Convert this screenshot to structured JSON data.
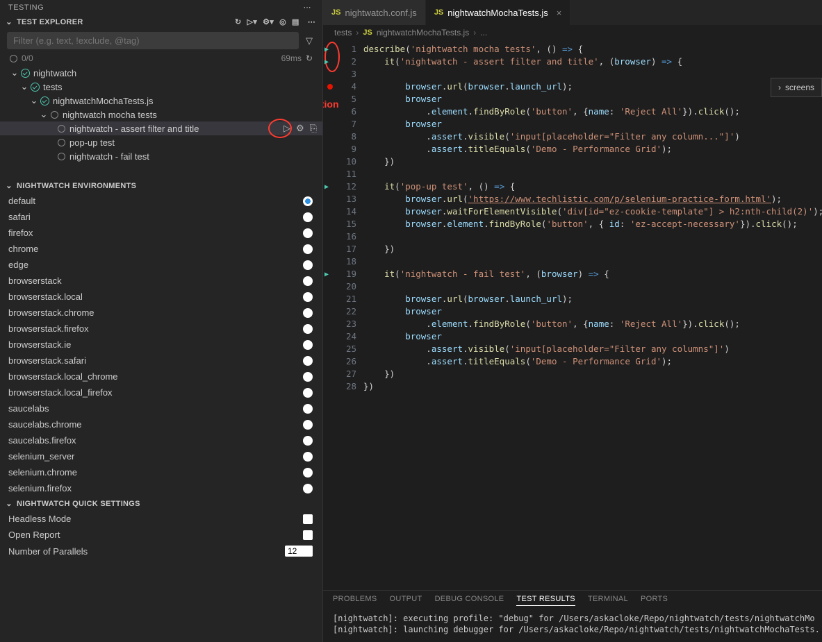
{
  "sidebar": {
    "panel_title": "TESTING",
    "explorer": {
      "title": "TEST EXPLORER",
      "filter_placeholder": "Filter (e.g. text, !exclude, @tag)",
      "stats_count": "0/0",
      "stats_time": "69ms"
    },
    "tree": {
      "root": "nightwatch",
      "tests_folder": "tests",
      "file": "nightwatchMochaTests.js",
      "suite": "nightwatch mocha tests",
      "tests": [
        "nightwatch - assert filter and title",
        "pop-up test",
        "nightwatch - fail test"
      ]
    },
    "envs": {
      "title": "NIGHTWATCH ENVIRONMENTS",
      "items": [
        "default",
        "safari",
        "firefox",
        "chrome",
        "edge",
        "browserstack",
        "browserstack.local",
        "browserstack.chrome",
        "browserstack.firefox",
        "browserstack.ie",
        "browserstack.safari",
        "browserstack.local_chrome",
        "browserstack.local_firefox",
        "saucelabs",
        "saucelabs.chrome",
        "saucelabs.firefox",
        "selenium_server",
        "selenium.chrome",
        "selenium.firefox"
      ],
      "selected_index": 0
    },
    "quick": {
      "title": "NIGHTWATCH QUICK SETTINGS",
      "headless": "Headless Mode",
      "open_report": "Open Report",
      "parallels_label": "Number of Parallels",
      "parallels_value": "12"
    }
  },
  "tabs": {
    "inactive": "nightwatch.conf.js",
    "active": "nightwatchMochaTests.js"
  },
  "breadcrumb": {
    "tests": "tests",
    "file": "nightwatchMochaTests.js",
    "trail": "..."
  },
  "annotation_label": "Test Execution",
  "floater": {
    "label": "screens"
  },
  "code": {
    "l1": {
      "a": "describe",
      "b": "(",
      "c": "'nightwatch mocha tests'",
      "d": ", () ",
      "e": "=>",
      "f": " {"
    },
    "l2": {
      "a": "    it",
      "b": "(",
      "c": "'nightwatch - assert filter and title'",
      "d": ", (",
      "e": "browser",
      "f": ") ",
      "g": "=>",
      "h": " {"
    },
    "l4": {
      "a": "        browser",
      "b": ".",
      "c": "url",
      "d": "(",
      "e": "browser",
      "f": ".",
      "g": "launch_url",
      "h": ");"
    },
    "l5": {
      "a": "        browser"
    },
    "l6": {
      "a": "            .",
      "b": "element",
      "c": ".",
      "d": "findByRole",
      "e": "(",
      "f": "'button'",
      "g": ", {",
      "h": "name",
      "i": ": ",
      "j": "'Reject All'",
      "k": "}).",
      "l": "click",
      "m": "();"
    },
    "l7": {
      "a": "        browser"
    },
    "l8": {
      "a": "            .",
      "b": "assert",
      "c": ".",
      "d": "visible",
      "e": "(",
      "f": "'input[placeholder=\"Filter any column...\"]'",
      "g": ")"
    },
    "l9": {
      "a": "            .",
      "b": "assert",
      "c": ".",
      "d": "titleEquals",
      "e": "(",
      "f": "'Demo - Performance Grid'",
      "g": ");"
    },
    "l10": {
      "a": "    })"
    },
    "l12": {
      "a": "    it",
      "b": "(",
      "c": "'pop-up test'",
      "d": ", () ",
      "e": "=>",
      "f": " {"
    },
    "l13": {
      "a": "        browser",
      "b": ".",
      "c": "url",
      "d": "(",
      "e": "'https://www.techlistic.com/p/selenium-practice-form.html'",
      "f": ");"
    },
    "l14": {
      "a": "        browser",
      "b": ".",
      "c": "waitForElementVisible",
      "d": "(",
      "e": "'div[id=\"ez-cookie-template\"] > h2:nth-child(2)'",
      "f": ");"
    },
    "l15": {
      "a": "        browser",
      "b": ".",
      "c": "element",
      "d": ".",
      "e": "findByRole",
      "f": "(",
      "g": "'button'",
      "h": ", { ",
      "i": "id",
      "j": ": ",
      "k": "'ez-accept-necessary'",
      "l": "}).",
      "m": "click",
      "n": "();"
    },
    "l17": {
      "a": "    })"
    },
    "l19": {
      "a": "    it",
      "b": "(",
      "c": "'nightwatch - fail test'",
      "d": ", (",
      "e": "browser",
      "f": ") ",
      "g": "=>",
      "h": " {"
    },
    "l21": {
      "a": "        browser",
      "b": ".",
      "c": "url",
      "d": "(",
      "e": "browser",
      "f": ".",
      "g": "launch_url",
      "h": ");"
    },
    "l22": {
      "a": "        browser"
    },
    "l23": {
      "a": "            .",
      "b": "element",
      "c": ".",
      "d": "findByRole",
      "e": "(",
      "f": "'button'",
      "g": ", {",
      "h": "name",
      "i": ": ",
      "j": "'Reject All'",
      "k": "}).",
      "l": "click",
      "m": "();"
    },
    "l24": {
      "a": "        browser"
    },
    "l25": {
      "a": "            .",
      "b": "assert",
      "c": ".",
      "d": "visible",
      "e": "(",
      "f": "'input[placeholder=\"Filter any columns\"]'",
      "g": ")"
    },
    "l26": {
      "a": "            .",
      "b": "assert",
      "c": ".",
      "d": "titleEquals",
      "e": "(",
      "f": "'Demo - Performance Grid'",
      "g": ");"
    },
    "l27": {
      "a": "    })"
    },
    "l28": {
      "a": "})"
    }
  },
  "panel": {
    "tabs": [
      "PROBLEMS",
      "OUTPUT",
      "DEBUG CONSOLE",
      "TEST RESULTS",
      "TERMINAL",
      "PORTS"
    ],
    "active_index": 3,
    "lines": [
      "[nightwatch]: executing profile: \"debug\" for /Users/askacloke/Repo/nightwatch/tests/nightwatchMo",
      "[nightwatch]: launching debugger for /Users/askacloke/Repo/nightwatch/tests/nightwatchMochaTests."
    ]
  }
}
